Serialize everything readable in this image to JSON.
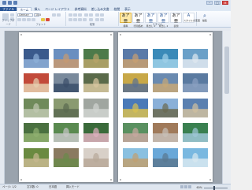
{
  "titlebar": {
    "controls": [
      "–",
      "□",
      "×"
    ]
  },
  "tabs": [
    "ファイル",
    "ホーム",
    "挿入",
    "ページ レイアウト",
    "参考資料",
    "差し込み文書",
    "校閲",
    "表示"
  ],
  "ribbon": {
    "font_name": "Century",
    "font_size": "10.5",
    "groups": {
      "clipboard": "クリップボード",
      "font": "フォント",
      "paragraph": "段落",
      "styles": "スタイル",
      "editing": "編集"
    },
    "styles": [
      {
        "sample": "あア亜",
        "name": "標準"
      },
      {
        "sample": "あア亜",
        "name": "行間詰め"
      },
      {
        "sample": "あア亜",
        "name": "見出し 1"
      },
      {
        "sample": "あア亜",
        "name": "見出し 2"
      },
      {
        "sample": "あア亜",
        "name": "表題"
      }
    ],
    "change_styles": "スタイルの変更",
    "editing_label": "編集"
  },
  "status": {
    "page": "ページ: 1/2",
    "words": "文字数: 0",
    "language": "日本語",
    "mode": "挿入モード",
    "zoom": "60%"
  },
  "pages": [
    {
      "photos": [
        [
          "#3a5a8c",
          "#8fb0d8"
        ],
        [
          "#6a8fc0",
          "#c89a70"
        ],
        [
          "#4d7a4a",
          "#b9a46a"
        ],
        [
          "#c24a3a",
          "#e6d0b0"
        ],
        [
          "#7a8a9c",
          "#3a4d6a"
        ],
        [
          "#5a6a4a",
          "#d8c8a0"
        ],
        [
          "#6f8a5a",
          "#c0c8b0"
        ],
        [
          "#8a9a70",
          "#5a6a50"
        ],
        [
          "#a0a6a0",
          "#d0d4d0"
        ],
        [
          "#4a7040",
          "#90b070"
        ],
        [
          "#5a8a50",
          "#c8c8c8"
        ],
        [
          "#3a6a3a",
          "#e0b0c0"
        ],
        [
          "#6a8a40",
          "#c8b890"
        ],
        [
          "#8a7a60",
          "#6a8a4a"
        ],
        [
          "#d8d0c8",
          "#b8a898"
        ]
      ]
    },
    {
      "photos": [
        [
          "#5a7aa8",
          "#c9a070"
        ],
        [
          "#3a8ab8",
          "#9fd0e8"
        ],
        [
          "#6aa0c8",
          "#e0e8f0"
        ],
        [
          "#c8a848",
          "#5a7090"
        ],
        [
          "#6a8ab0",
          "#c8a878"
        ],
        [
          "#5a7aa0",
          "#8aa0c0"
        ],
        [
          "#4a7ab8",
          "#d8c050"
        ],
        [
          "#8ab0d8",
          "#6a6a50"
        ],
        [
          "#5a80b0",
          "#d0c0a0"
        ],
        [
          "#5a9060",
          "#c8a8a0"
        ],
        [
          "#a07a5a",
          "#c8c0b8"
        ],
        [
          "#3a8050",
          "#a0c8d8"
        ],
        [
          "#8ac0e0",
          "#c0a070"
        ],
        [
          "#6aa8d8",
          "#5a7890"
        ],
        [
          "#7ab8e0",
          "#d8e8f0"
        ]
      ]
    }
  ]
}
